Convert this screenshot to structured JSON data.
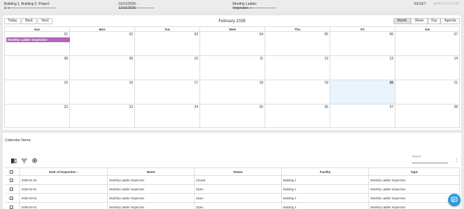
{
  "filters": {
    "building": "Building 1, Building 2, Project 1",
    "date_range": "01/01/2026 - 12/31/2026",
    "type": "Monthly Ladder Inspection",
    "reset_label": "RESET",
    "apply_label": "APPLY FILTER"
  },
  "calendar": {
    "nav": {
      "today": "Today",
      "back": "Back",
      "next": "Next"
    },
    "title": "February 2026",
    "views": [
      "Month",
      "Week",
      "Day",
      "Agenda"
    ],
    "weekdays": [
      "Sun",
      "Mon",
      "Tue",
      "Wed",
      "Thu",
      "Fri",
      "Sat"
    ],
    "weeks": [
      [
        "01",
        "02",
        "03",
        "04",
        "05",
        "06",
        "07"
      ],
      [
        "08",
        "09",
        "10",
        "11",
        "12",
        "13",
        "14"
      ],
      [
        "15",
        "16",
        "17",
        "18",
        "19",
        "20",
        "21"
      ],
      [
        "22",
        "23",
        "24",
        "25",
        "26",
        "27",
        "28"
      ]
    ],
    "event_label": "Monthly Ladder Inspection",
    "event_color": "#b266b8",
    "today_bg": "#e8f4fe"
  },
  "items": {
    "title": "Calendar Items",
    "search_label": "Search",
    "icons": [
      "columns-icon",
      "filter-icon",
      "gear-icon"
    ],
    "columns": [
      "Date of Inspection",
      "Name",
      "Status",
      "Facility",
      "Type"
    ],
    "rows": [
      [
        "2026-01-01",
        "Monthly Ladder Inspection",
        "Closed",
        "Building 1",
        "Monthly Ladder Inspection"
      ],
      [
        "2026-02-01",
        "Monthly Ladder Inspection",
        "Open",
        "Building 1",
        "Monthly Ladder Inspection"
      ],
      [
        "2026-03-01",
        "Monthly Ladder Inspection",
        "Open",
        "Building 1",
        "Monthly Ladder Inspection"
      ],
      [
        "2026-04-01",
        "Monthly Ladder Inspection",
        "Open",
        "Building 1",
        "Monthly Ladder Inspection"
      ]
    ]
  }
}
